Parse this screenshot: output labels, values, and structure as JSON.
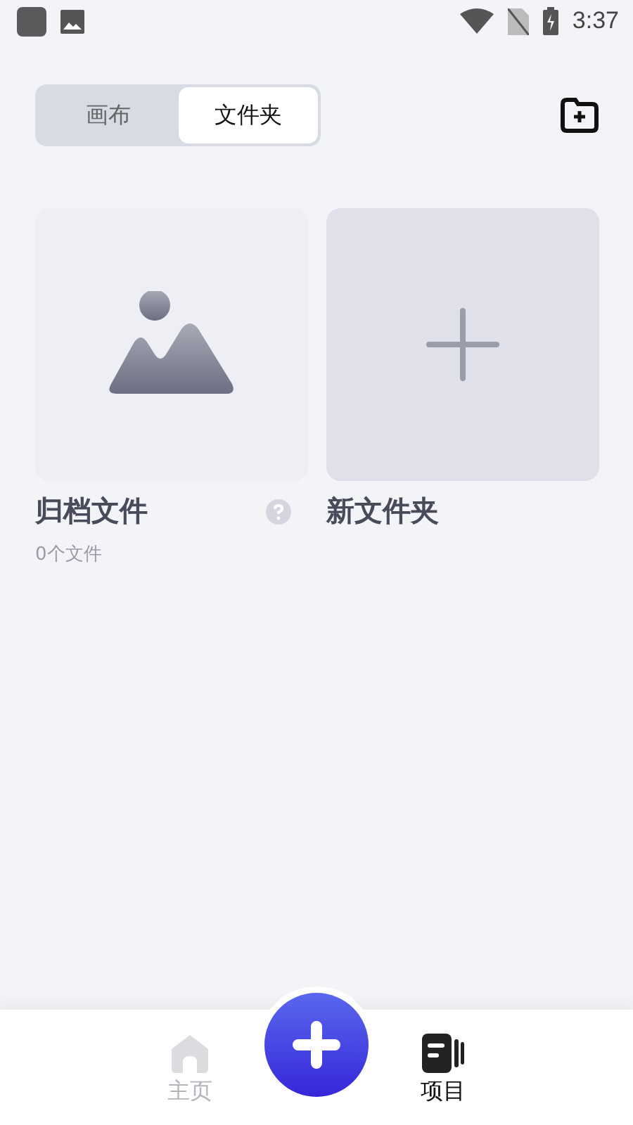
{
  "status_bar": {
    "time": "3:37"
  },
  "segment_tabs": [
    {
      "label": "画布",
      "selected": false
    },
    {
      "label": "文件夹",
      "selected": true
    }
  ],
  "folders": [
    {
      "kind": "archive",
      "name": "归档文件",
      "subtitle": "0个文件"
    },
    {
      "kind": "new",
      "name": "新文件夹"
    }
  ],
  "bottom_nav": [
    {
      "label": "主页",
      "kind": "home",
      "selected": false
    },
    {
      "label": "项目",
      "kind": "projects",
      "selected": true
    }
  ]
}
